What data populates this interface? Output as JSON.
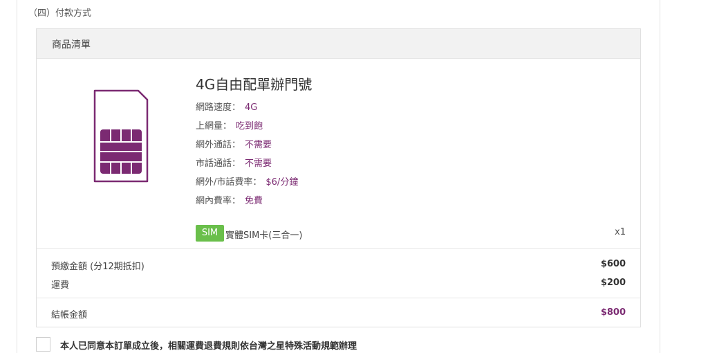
{
  "section": {
    "title": "（四）付款方式"
  },
  "cart": {
    "header": "商品清單",
    "product": {
      "name": "4G自由配單辦門號",
      "specs": [
        {
          "label": "網路速度：",
          "value": "4G"
        },
        {
          "label": "上網量：",
          "value": "吃到飽"
        },
        {
          "label": "網外通話：",
          "value": "不需要"
        },
        {
          "label": "市話通話：",
          "value": "不需要"
        },
        {
          "label": "網外/市話費率：",
          "value": "$6/分鐘"
        },
        {
          "label": "網內費率：",
          "value": "免費"
        }
      ],
      "sim_badge": "SIM",
      "sim_type": "實體SIM卡(三合一)",
      "quantity": "x1",
      "icon": "sim-card-icon",
      "accent_color": "#7b2a72"
    },
    "summary": [
      {
        "label": "預繳金額 (分12期抵扣)",
        "value": "$600"
      },
      {
        "label": "運費",
        "value": "$200"
      }
    ],
    "total": {
      "label": "結帳金額",
      "value": "$800"
    }
  },
  "agreement": {
    "text": "本人已同意本訂單成立後，相關運費退費規則依台灣之星特殊活動規範辦理",
    "checked": false
  },
  "colors": {
    "badge_green": "#6abf4b",
    "accent_purple": "#7b2a72"
  }
}
